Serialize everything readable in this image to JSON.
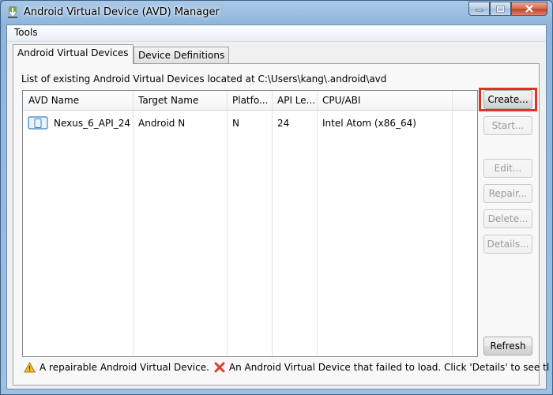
{
  "window": {
    "title": "Android Virtual Device (AVD) Manager",
    "controls": [
      "minimize-icon",
      "maximize-icon",
      "close-icon"
    ]
  },
  "menu": {
    "tools": "Tools"
  },
  "tabs": [
    {
      "label": "Android Virtual Devices",
      "active": true
    },
    {
      "label": "Device Definitions",
      "active": false
    }
  ],
  "list_label": "List of existing Android Virtual Devices located at C:\\Users\\kang\\.android\\avd",
  "table": {
    "headers": [
      "AVD Name",
      "Target Name",
      "Platfo...",
      "API Le...",
      "CPU/ABI"
    ],
    "rows": [
      {
        "avd_name": "Nexus_6_API_24",
        "target_name": "Android N",
        "platform": "N",
        "api_level": "24",
        "cpu_abi": "Intel Atom (x86_64)",
        "icon": "device-icon"
      }
    ]
  },
  "buttons": {
    "create": {
      "label": "Create...",
      "enabled": true
    },
    "start": {
      "label": "Start...",
      "enabled": false
    },
    "edit": {
      "label": "Edit...",
      "enabled": false
    },
    "repair": {
      "label": "Repair...",
      "enabled": false
    },
    "delete": {
      "label": "Delete...",
      "enabled": false
    },
    "details": {
      "label": "Details...",
      "enabled": false
    },
    "refresh": {
      "label": "Refresh",
      "enabled": true
    }
  },
  "legend": {
    "warning_text": "A repairable Android Virtual Device.",
    "error_text": "An Android Virtual Device that failed to load. Click 'Details' to see tl"
  },
  "colors": {
    "highlight": "#e0302a",
    "title_gradient": "#a9c9e8",
    "close_button": "#c4402a"
  }
}
